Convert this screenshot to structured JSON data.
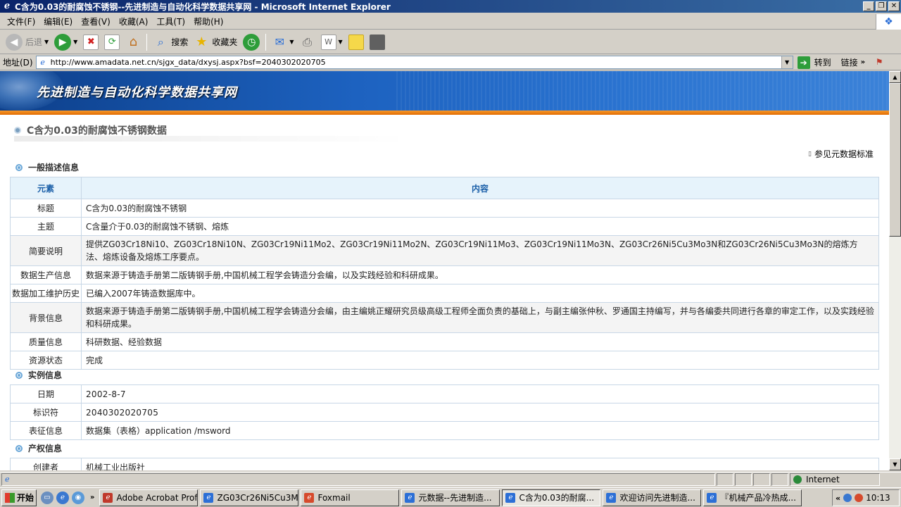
{
  "window": {
    "title": "C含为0.03的耐腐蚀不锈钢--先进制造与自动化科学数据共享网 - Microsoft Internet Explorer",
    "minimize": "_",
    "restore": "❐",
    "close": "✕"
  },
  "menu": [
    "文件(F)",
    "编辑(E)",
    "查看(V)",
    "收藏(A)",
    "工具(T)",
    "帮助(H)"
  ],
  "toolbar": {
    "back": "后退",
    "search": "搜索",
    "favorites": "收藏夹"
  },
  "address": {
    "label": "地址(D)",
    "url": "http://www.amadata.net.cn/sjgx_data/dxysj.aspx?bsf=2040302020705",
    "go": "转到",
    "links": "链接"
  },
  "site": {
    "title": "先进制造与自动化科学数据共享网"
  },
  "page": {
    "heading": "C含为0.03的耐腐蚀不锈钢数据",
    "meta_link": "参见元数据标准"
  },
  "sections": {
    "general": "一般描述信息",
    "instance": "实例信息",
    "rights": "产权信息"
  },
  "general_table": {
    "headers": [
      "元素",
      "内容"
    ],
    "rows": [
      {
        "key": "标题",
        "value": "C含为0.03的耐腐蚀不锈钢"
      },
      {
        "key": "主题",
        "value": "C含量介于0.03的耐腐蚀不锈钢、熔炼"
      },
      {
        "key": "简要说明",
        "value": "提供ZG03Cr18Ni10、ZG03Cr18Ni10N、ZG03Cr19Ni11Mo2、ZG03Cr19Ni11Mo2N、ZG03Cr19Ni11Mo3、ZG03Cr19Ni11Mo3N、ZG03Cr26Ni5Cu3Mo3N和ZG03Cr26Ni5Cu3Mo3N的熔炼方法、熔炼设备及熔炼工序要点。"
      },
      {
        "key": "数据生产信息",
        "value": "数据来源于铸造手册第二版铸钢手册,中国机械工程学会铸造分会编，以及实践经验和科研成果。"
      },
      {
        "key": "数据加工维护历史",
        "value": "已编入2007年铸造数据库中。"
      },
      {
        "key": "背景信息",
        "value": "数据来源于铸造手册第二版铸钢手册,中国机械工程学会铸造分会编，由主编姚正耀研究员级高级工程师全面负责的基础上，与副主编张仲秋、罗通国主持编写，并与各编委共同进行各章的审定工作，以及实践经验和科研成果。"
      },
      {
        "key": "质量信息",
        "value": "科研数据、经验数据"
      },
      {
        "key": "资源状态",
        "value": "完成"
      }
    ]
  },
  "instance_table": {
    "rows": [
      {
        "key": "日期",
        "value": "2002-8-7"
      },
      {
        "key": "标识符",
        "value": "2040302020705"
      },
      {
        "key": "表征信息",
        "value": "数据集（表格）application /msword"
      }
    ]
  },
  "rights_table": {
    "rows": [
      {
        "key": "创建者",
        "value": "机械工业出版社"
      }
    ]
  },
  "status": {
    "zone": "Internet"
  },
  "taskbar": {
    "start": "开始",
    "more": "»",
    "tasks": [
      {
        "label": "Adobe Acrobat Prof...",
        "color": "#c0392b",
        "active": false
      },
      {
        "label": "ZG03Cr26Ni5Cu3Mo...",
        "color": "#2c6fd6",
        "active": false
      },
      {
        "label": "Foxmail",
        "color": "#d64a2c",
        "active": false
      },
      {
        "label": "元数据--先进制造...",
        "color": "#2c6fd6",
        "active": false
      },
      {
        "label": "C含为0.03的耐腐...",
        "color": "#2c6fd6",
        "active": true
      },
      {
        "label": "欢迎访问先进制造...",
        "color": "#2c6fd6",
        "active": false
      },
      {
        "label": "『机械产品冷热成...",
        "color": "#2c6fd6",
        "active": false
      }
    ],
    "tray_more": "«",
    "clock": "10:13"
  }
}
